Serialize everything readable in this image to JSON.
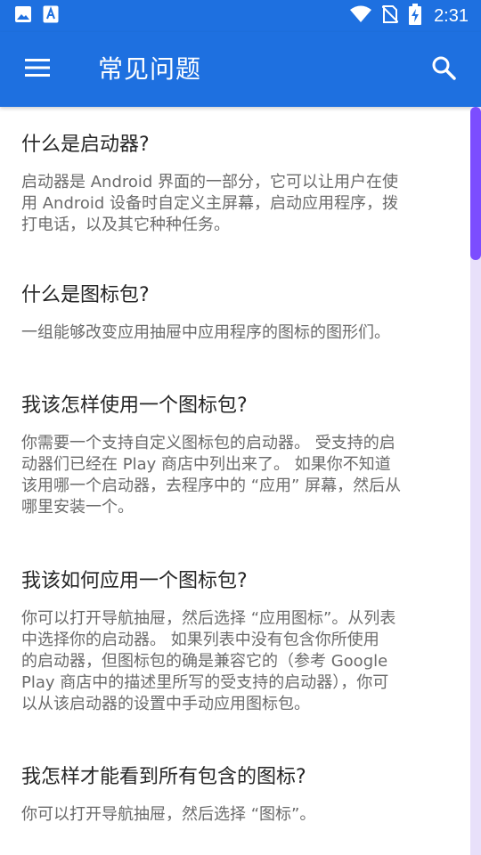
{
  "status_bar": {
    "time": "2:31",
    "left_icons": [
      "image-icon",
      "a11y-text-icon"
    ],
    "right_icons": [
      "wifi-icon",
      "no-sim-icon",
      "battery-charging-icon"
    ]
  },
  "app_bar": {
    "title": "常见问题",
    "menu_icon": "menu-icon",
    "search_icon": "search-icon",
    "color": "#1e70e0"
  },
  "faqs": [
    {
      "question": "什么是启动器?",
      "answer_lines": [
        "启动器是 Android 界面的一部分，它可以让用户在使",
        "用 Android 设备时自定义主屏幕，启动应用程序，拨",
        "打电话，以及其它种种任务。"
      ]
    },
    {
      "question": "什么是图标包?",
      "answer_lines": [
        "一组能够改变应用抽屉中应用程序的图标的图形们。"
      ]
    },
    {
      "question": "我该怎样使用一个图标包?",
      "answer_lines": [
        "你需要一个支持自定义图标包的启动器。 受支持的启",
        "动器们已经在 Play 商店中列出来了。 如果你不知道",
        "该用哪一个启动器，去程序中的 “应用” 屏幕，然后从",
        "哪里安装一个。"
      ]
    },
    {
      "question": "我该如何应用一个图标包?",
      "answer_lines": [
        "你可以打开导航抽屉，然后选择 “应用图标”。从列表",
        "中选择你的启动器。 如果列表中没有包含你所使用",
        "的启动器，但图标包的确是兼容它的（参考 Google",
        "Play 商店中的描述里所写的受支持的启动器），你可",
        "以从该启动器的设置中手动应用图标包。"
      ]
    },
    {
      "question": "我怎样才能看到所有包含的图标?",
      "answer_lines": [
        "你可以打开导航抽屉，然后选择 “图标”。"
      ]
    }
  ],
  "scrollbar": {
    "thumb_color": "#7c4dff",
    "track_color": "#e8e0fa",
    "scroll_position": 0
  }
}
